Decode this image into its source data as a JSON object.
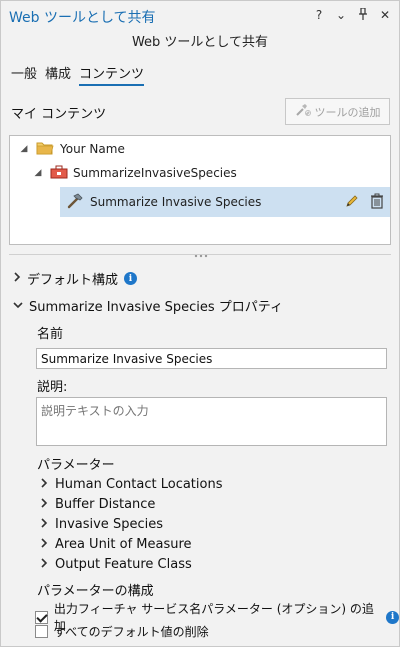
{
  "window": {
    "title": "Web ツールとして共有",
    "controls": [
      "?",
      "⌄",
      "📌",
      "✕"
    ]
  },
  "subtitle": "Web ツールとして共有",
  "tabs": [
    {
      "label": "一般",
      "active": false
    },
    {
      "label": "構成",
      "active": false
    },
    {
      "label": "コンテンツ",
      "active": true
    }
  ],
  "content": {
    "section_title": "マイ コンテンツ",
    "add_tool_label": "ツールの追加"
  },
  "tree": {
    "folder_label": "Your Name",
    "service_label": "SummarizeInvasiveSpecies",
    "tool_label": "Summarize Invasive Species"
  },
  "sections": {
    "default_config": "デフォルト構成",
    "properties_title": "Summarize Invasive Species プロパティ"
  },
  "props": {
    "name_label": "名前",
    "name_value": "Summarize Invasive Species",
    "desc_label": "説明:",
    "desc_placeholder": "説明テキストの入力",
    "params_label": "パラメーター",
    "params": [
      "Human Contact Locations",
      "Buffer Distance",
      "Invasive Species",
      "Area Unit of Measure",
      "Output Feature Class"
    ],
    "param_config_label": "パラメーターの構成",
    "check_add_service_name": "出力フィーチャ サービス名パラメーター (オプション) の追加",
    "check_add_service_name_checked": true,
    "check_remove_defaults": "すべてのデフォルト値の削除",
    "check_remove_defaults_checked": false
  },
  "colors": {
    "accent": "#1a6fb3",
    "selection": "#cde0f1",
    "info": "#1f77c9",
    "folder": "#e8b64a",
    "service": "#c0392b"
  }
}
